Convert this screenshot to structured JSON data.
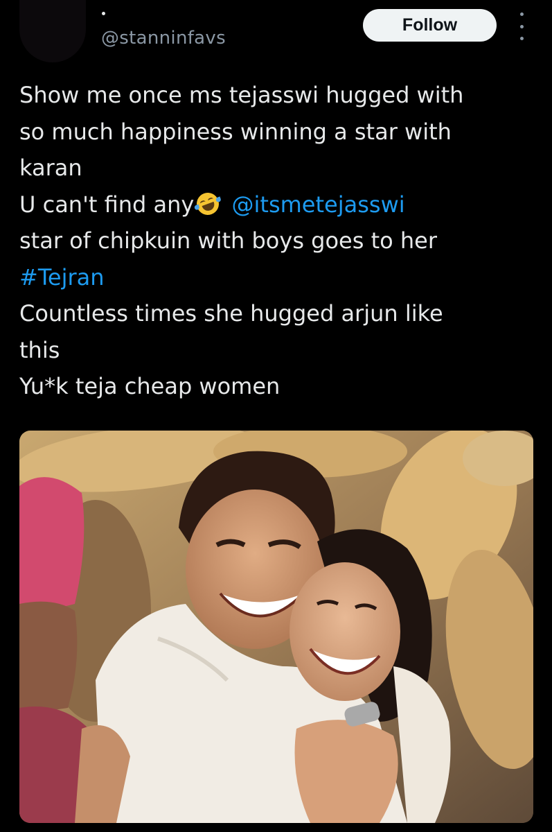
{
  "author": {
    "handle": "@stanninfavs"
  },
  "actions": {
    "follow_label": "Follow",
    "more_icon": "more-options-icon"
  },
  "tweet": {
    "lines": [
      "Show me once ms tejasswi hugged with",
      "so much happiness winning a star with",
      "karan",
      "U can't find any",
      "star of chipkuin with boys goes to her",
      "#Tejran",
      "Countless times she hugged arjun like",
      "this",
      "Yu*k teja cheap women"
    ],
    "mention": "@itsmetejasswi",
    "emoji": "rolling-on-floor-laughing-emoji"
  },
  "colors": {
    "background": "#000000",
    "text": "#e7e9ea",
    "secondary": "#8b98a5",
    "link": "#1d9bf0",
    "follow_bg": "#eff3f4"
  }
}
